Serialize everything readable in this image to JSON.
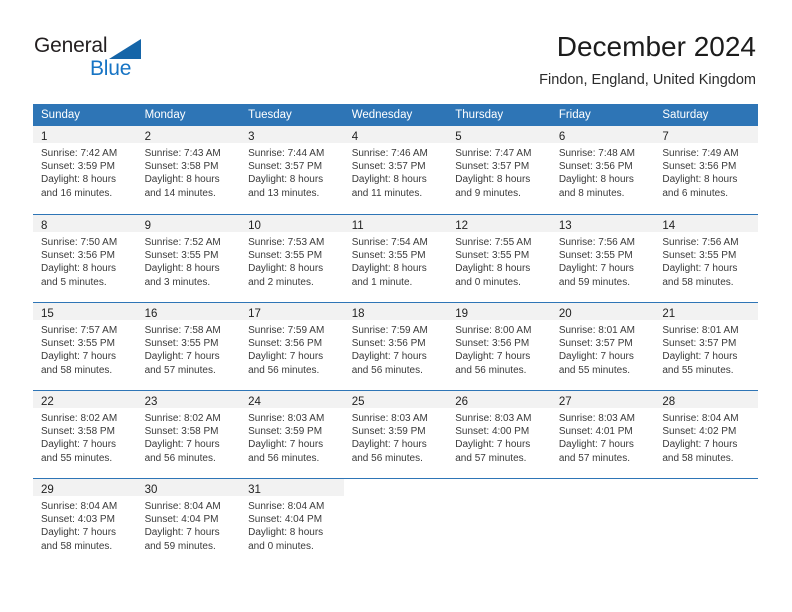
{
  "brand": {
    "name_part1": "General",
    "name_part2": "Blue",
    "triangle_icon": "blue-triangle-icon",
    "colors": {
      "dark_text": "#231f20",
      "blue": "#1774c4",
      "triangle": "#1565a8"
    }
  },
  "header": {
    "month_title": "December 2024",
    "location": "Findon, England, United Kingdom"
  },
  "theme": {
    "header_blue": "#2e75b6",
    "date_band_gray": "#f2f2f2",
    "body_text": "#3a3a3a"
  },
  "weekday_headers": [
    "Sunday",
    "Monday",
    "Tuesday",
    "Wednesday",
    "Thursday",
    "Friday",
    "Saturday"
  ],
  "weeks": [
    [
      {
        "date": "1",
        "sunrise": "Sunrise: 7:42 AM",
        "sunset": "Sunset: 3:59 PM",
        "daylight_line1": "Daylight: 8 hours",
        "daylight_line2": "and 16 minutes."
      },
      {
        "date": "2",
        "sunrise": "Sunrise: 7:43 AM",
        "sunset": "Sunset: 3:58 PM",
        "daylight_line1": "Daylight: 8 hours",
        "daylight_line2": "and 14 minutes."
      },
      {
        "date": "3",
        "sunrise": "Sunrise: 7:44 AM",
        "sunset": "Sunset: 3:57 PM",
        "daylight_line1": "Daylight: 8 hours",
        "daylight_line2": "and 13 minutes."
      },
      {
        "date": "4",
        "sunrise": "Sunrise: 7:46 AM",
        "sunset": "Sunset: 3:57 PM",
        "daylight_line1": "Daylight: 8 hours",
        "daylight_line2": "and 11 minutes."
      },
      {
        "date": "5",
        "sunrise": "Sunrise: 7:47 AM",
        "sunset": "Sunset: 3:57 PM",
        "daylight_line1": "Daylight: 8 hours",
        "daylight_line2": "and 9 minutes."
      },
      {
        "date": "6",
        "sunrise": "Sunrise: 7:48 AM",
        "sunset": "Sunset: 3:56 PM",
        "daylight_line1": "Daylight: 8 hours",
        "daylight_line2": "and 8 minutes."
      },
      {
        "date": "7",
        "sunrise": "Sunrise: 7:49 AM",
        "sunset": "Sunset: 3:56 PM",
        "daylight_line1": "Daylight: 8 hours",
        "daylight_line2": "and 6 minutes."
      }
    ],
    [
      {
        "date": "8",
        "sunrise": "Sunrise: 7:50 AM",
        "sunset": "Sunset: 3:56 PM",
        "daylight_line1": "Daylight: 8 hours",
        "daylight_line2": "and 5 minutes."
      },
      {
        "date": "9",
        "sunrise": "Sunrise: 7:52 AM",
        "sunset": "Sunset: 3:55 PM",
        "daylight_line1": "Daylight: 8 hours",
        "daylight_line2": "and 3 minutes."
      },
      {
        "date": "10",
        "sunrise": "Sunrise: 7:53 AM",
        "sunset": "Sunset: 3:55 PM",
        "daylight_line1": "Daylight: 8 hours",
        "daylight_line2": "and 2 minutes."
      },
      {
        "date": "11",
        "sunrise": "Sunrise: 7:54 AM",
        "sunset": "Sunset: 3:55 PM",
        "daylight_line1": "Daylight: 8 hours",
        "daylight_line2": "and 1 minute."
      },
      {
        "date": "12",
        "sunrise": "Sunrise: 7:55 AM",
        "sunset": "Sunset: 3:55 PM",
        "daylight_line1": "Daylight: 8 hours",
        "daylight_line2": "and 0 minutes."
      },
      {
        "date": "13",
        "sunrise": "Sunrise: 7:56 AM",
        "sunset": "Sunset: 3:55 PM",
        "daylight_line1": "Daylight: 7 hours",
        "daylight_line2": "and 59 minutes."
      },
      {
        "date": "14",
        "sunrise": "Sunrise: 7:56 AM",
        "sunset": "Sunset: 3:55 PM",
        "daylight_line1": "Daylight: 7 hours",
        "daylight_line2": "and 58 minutes."
      }
    ],
    [
      {
        "date": "15",
        "sunrise": "Sunrise: 7:57 AM",
        "sunset": "Sunset: 3:55 PM",
        "daylight_line1": "Daylight: 7 hours",
        "daylight_line2": "and 58 minutes."
      },
      {
        "date": "16",
        "sunrise": "Sunrise: 7:58 AM",
        "sunset": "Sunset: 3:55 PM",
        "daylight_line1": "Daylight: 7 hours",
        "daylight_line2": "and 57 minutes."
      },
      {
        "date": "17",
        "sunrise": "Sunrise: 7:59 AM",
        "sunset": "Sunset: 3:56 PM",
        "daylight_line1": "Daylight: 7 hours",
        "daylight_line2": "and 56 minutes."
      },
      {
        "date": "18",
        "sunrise": "Sunrise: 7:59 AM",
        "sunset": "Sunset: 3:56 PM",
        "daylight_line1": "Daylight: 7 hours",
        "daylight_line2": "and 56 minutes."
      },
      {
        "date": "19",
        "sunrise": "Sunrise: 8:00 AM",
        "sunset": "Sunset: 3:56 PM",
        "daylight_line1": "Daylight: 7 hours",
        "daylight_line2": "and 56 minutes."
      },
      {
        "date": "20",
        "sunrise": "Sunrise: 8:01 AM",
        "sunset": "Sunset: 3:57 PM",
        "daylight_line1": "Daylight: 7 hours",
        "daylight_line2": "and 55 minutes."
      },
      {
        "date": "21",
        "sunrise": "Sunrise: 8:01 AM",
        "sunset": "Sunset: 3:57 PM",
        "daylight_line1": "Daylight: 7 hours",
        "daylight_line2": "and 55 minutes."
      }
    ],
    [
      {
        "date": "22",
        "sunrise": "Sunrise: 8:02 AM",
        "sunset": "Sunset: 3:58 PM",
        "daylight_line1": "Daylight: 7 hours",
        "daylight_line2": "and 55 minutes."
      },
      {
        "date": "23",
        "sunrise": "Sunrise: 8:02 AM",
        "sunset": "Sunset: 3:58 PM",
        "daylight_line1": "Daylight: 7 hours",
        "daylight_line2": "and 56 minutes."
      },
      {
        "date": "24",
        "sunrise": "Sunrise: 8:03 AM",
        "sunset": "Sunset: 3:59 PM",
        "daylight_line1": "Daylight: 7 hours",
        "daylight_line2": "and 56 minutes."
      },
      {
        "date": "25",
        "sunrise": "Sunrise: 8:03 AM",
        "sunset": "Sunset: 3:59 PM",
        "daylight_line1": "Daylight: 7 hours",
        "daylight_line2": "and 56 minutes."
      },
      {
        "date": "26",
        "sunrise": "Sunrise: 8:03 AM",
        "sunset": "Sunset: 4:00 PM",
        "daylight_line1": "Daylight: 7 hours",
        "daylight_line2": "and 57 minutes."
      },
      {
        "date": "27",
        "sunrise": "Sunrise: 8:03 AM",
        "sunset": "Sunset: 4:01 PM",
        "daylight_line1": "Daylight: 7 hours",
        "daylight_line2": "and 57 minutes."
      },
      {
        "date": "28",
        "sunrise": "Sunrise: 8:04 AM",
        "sunset": "Sunset: 4:02 PM",
        "daylight_line1": "Daylight: 7 hours",
        "daylight_line2": "and 58 minutes."
      }
    ],
    [
      {
        "date": "29",
        "sunrise": "Sunrise: 8:04 AM",
        "sunset": "Sunset: 4:03 PM",
        "daylight_line1": "Daylight: 7 hours",
        "daylight_line2": "and 58 minutes."
      },
      {
        "date": "30",
        "sunrise": "Sunrise: 8:04 AM",
        "sunset": "Sunset: 4:04 PM",
        "daylight_line1": "Daylight: 7 hours",
        "daylight_line2": "and 59 minutes."
      },
      {
        "date": "31",
        "sunrise": "Sunrise: 8:04 AM",
        "sunset": "Sunset: 4:04 PM",
        "daylight_line1": "Daylight: 8 hours",
        "daylight_line2": "and 0 minutes."
      },
      {
        "date": "",
        "sunrise": "",
        "sunset": "",
        "daylight_line1": "",
        "daylight_line2": ""
      },
      {
        "date": "",
        "sunrise": "",
        "sunset": "",
        "daylight_line1": "",
        "daylight_line2": ""
      },
      {
        "date": "",
        "sunrise": "",
        "sunset": "",
        "daylight_line1": "",
        "daylight_line2": ""
      },
      {
        "date": "",
        "sunrise": "",
        "sunset": "",
        "daylight_line1": "",
        "daylight_line2": ""
      }
    ]
  ]
}
